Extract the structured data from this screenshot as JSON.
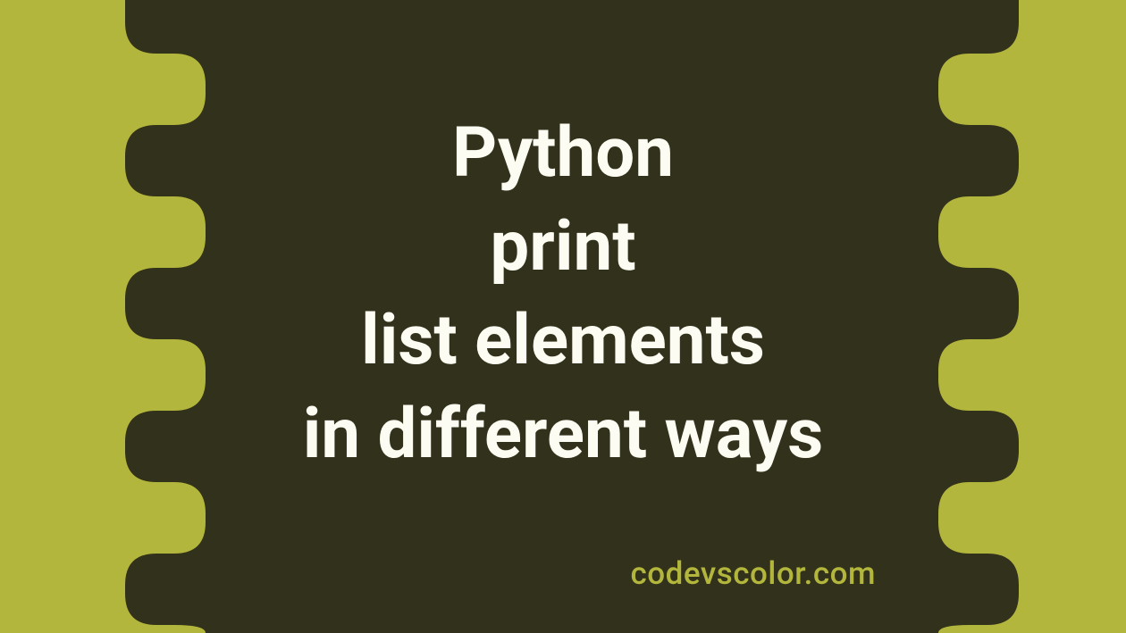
{
  "title": {
    "line1": "Python",
    "line2": "print",
    "line3": "list elements",
    "line4": "in different ways"
  },
  "attribution": "codevscolor.com",
  "colors": {
    "background": "#b3b63c",
    "blob": "#32311b",
    "text": "#fcfcf2",
    "attribution_text": "#b3b63c"
  }
}
